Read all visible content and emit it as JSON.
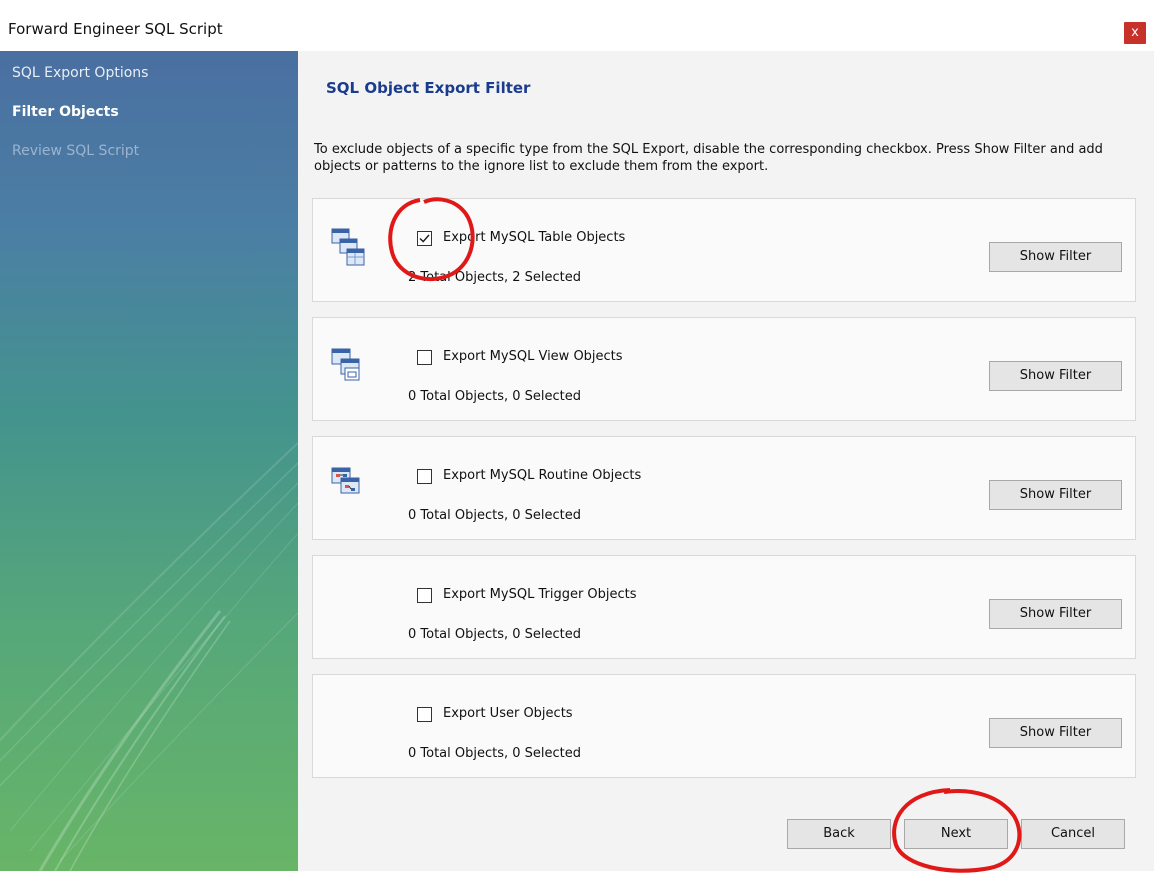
{
  "window": {
    "title": "Forward Engineer SQL Script",
    "close_label": "x"
  },
  "sidebar": {
    "steps": [
      {
        "label": "SQL Export Options",
        "state": "done"
      },
      {
        "label": "Filter Objects",
        "state": "current"
      },
      {
        "label": "Review SQL Script",
        "state": "pending"
      }
    ]
  },
  "main": {
    "heading": "SQL Object Export Filter",
    "description": "To exclude objects of a specific type from the SQL Export, disable the corresponding checkbox. Press Show Filter and add objects or patterns to the ignore list to exclude them from the export.",
    "filters": [
      {
        "label": "Export MySQL Table Objects",
        "checked": true,
        "count": "2 Total Objects, 2 Selected",
        "button": "Show Filter",
        "icon": "table-objects-icon"
      },
      {
        "label": "Export MySQL View Objects",
        "checked": false,
        "count": "0 Total Objects, 0 Selected",
        "button": "Show Filter",
        "icon": "view-objects-icon"
      },
      {
        "label": "Export MySQL Routine Objects",
        "checked": false,
        "count": "0 Total Objects, 0 Selected",
        "button": "Show Filter",
        "icon": "routine-objects-icon"
      },
      {
        "label": "Export MySQL Trigger Objects",
        "checked": false,
        "count": "0 Total Objects, 0 Selected",
        "button": "Show Filter",
        "icon": ""
      },
      {
        "label": "Export User Objects",
        "checked": false,
        "count": "0 Total Objects, 0 Selected",
        "button": "Show Filter",
        "icon": ""
      }
    ]
  },
  "footer": {
    "back": "Back",
    "next": "Next",
    "cancel": "Cancel"
  },
  "colors": {
    "annotation": "#e01818",
    "heading": "#1a3c8c",
    "close": "#c8312a"
  }
}
